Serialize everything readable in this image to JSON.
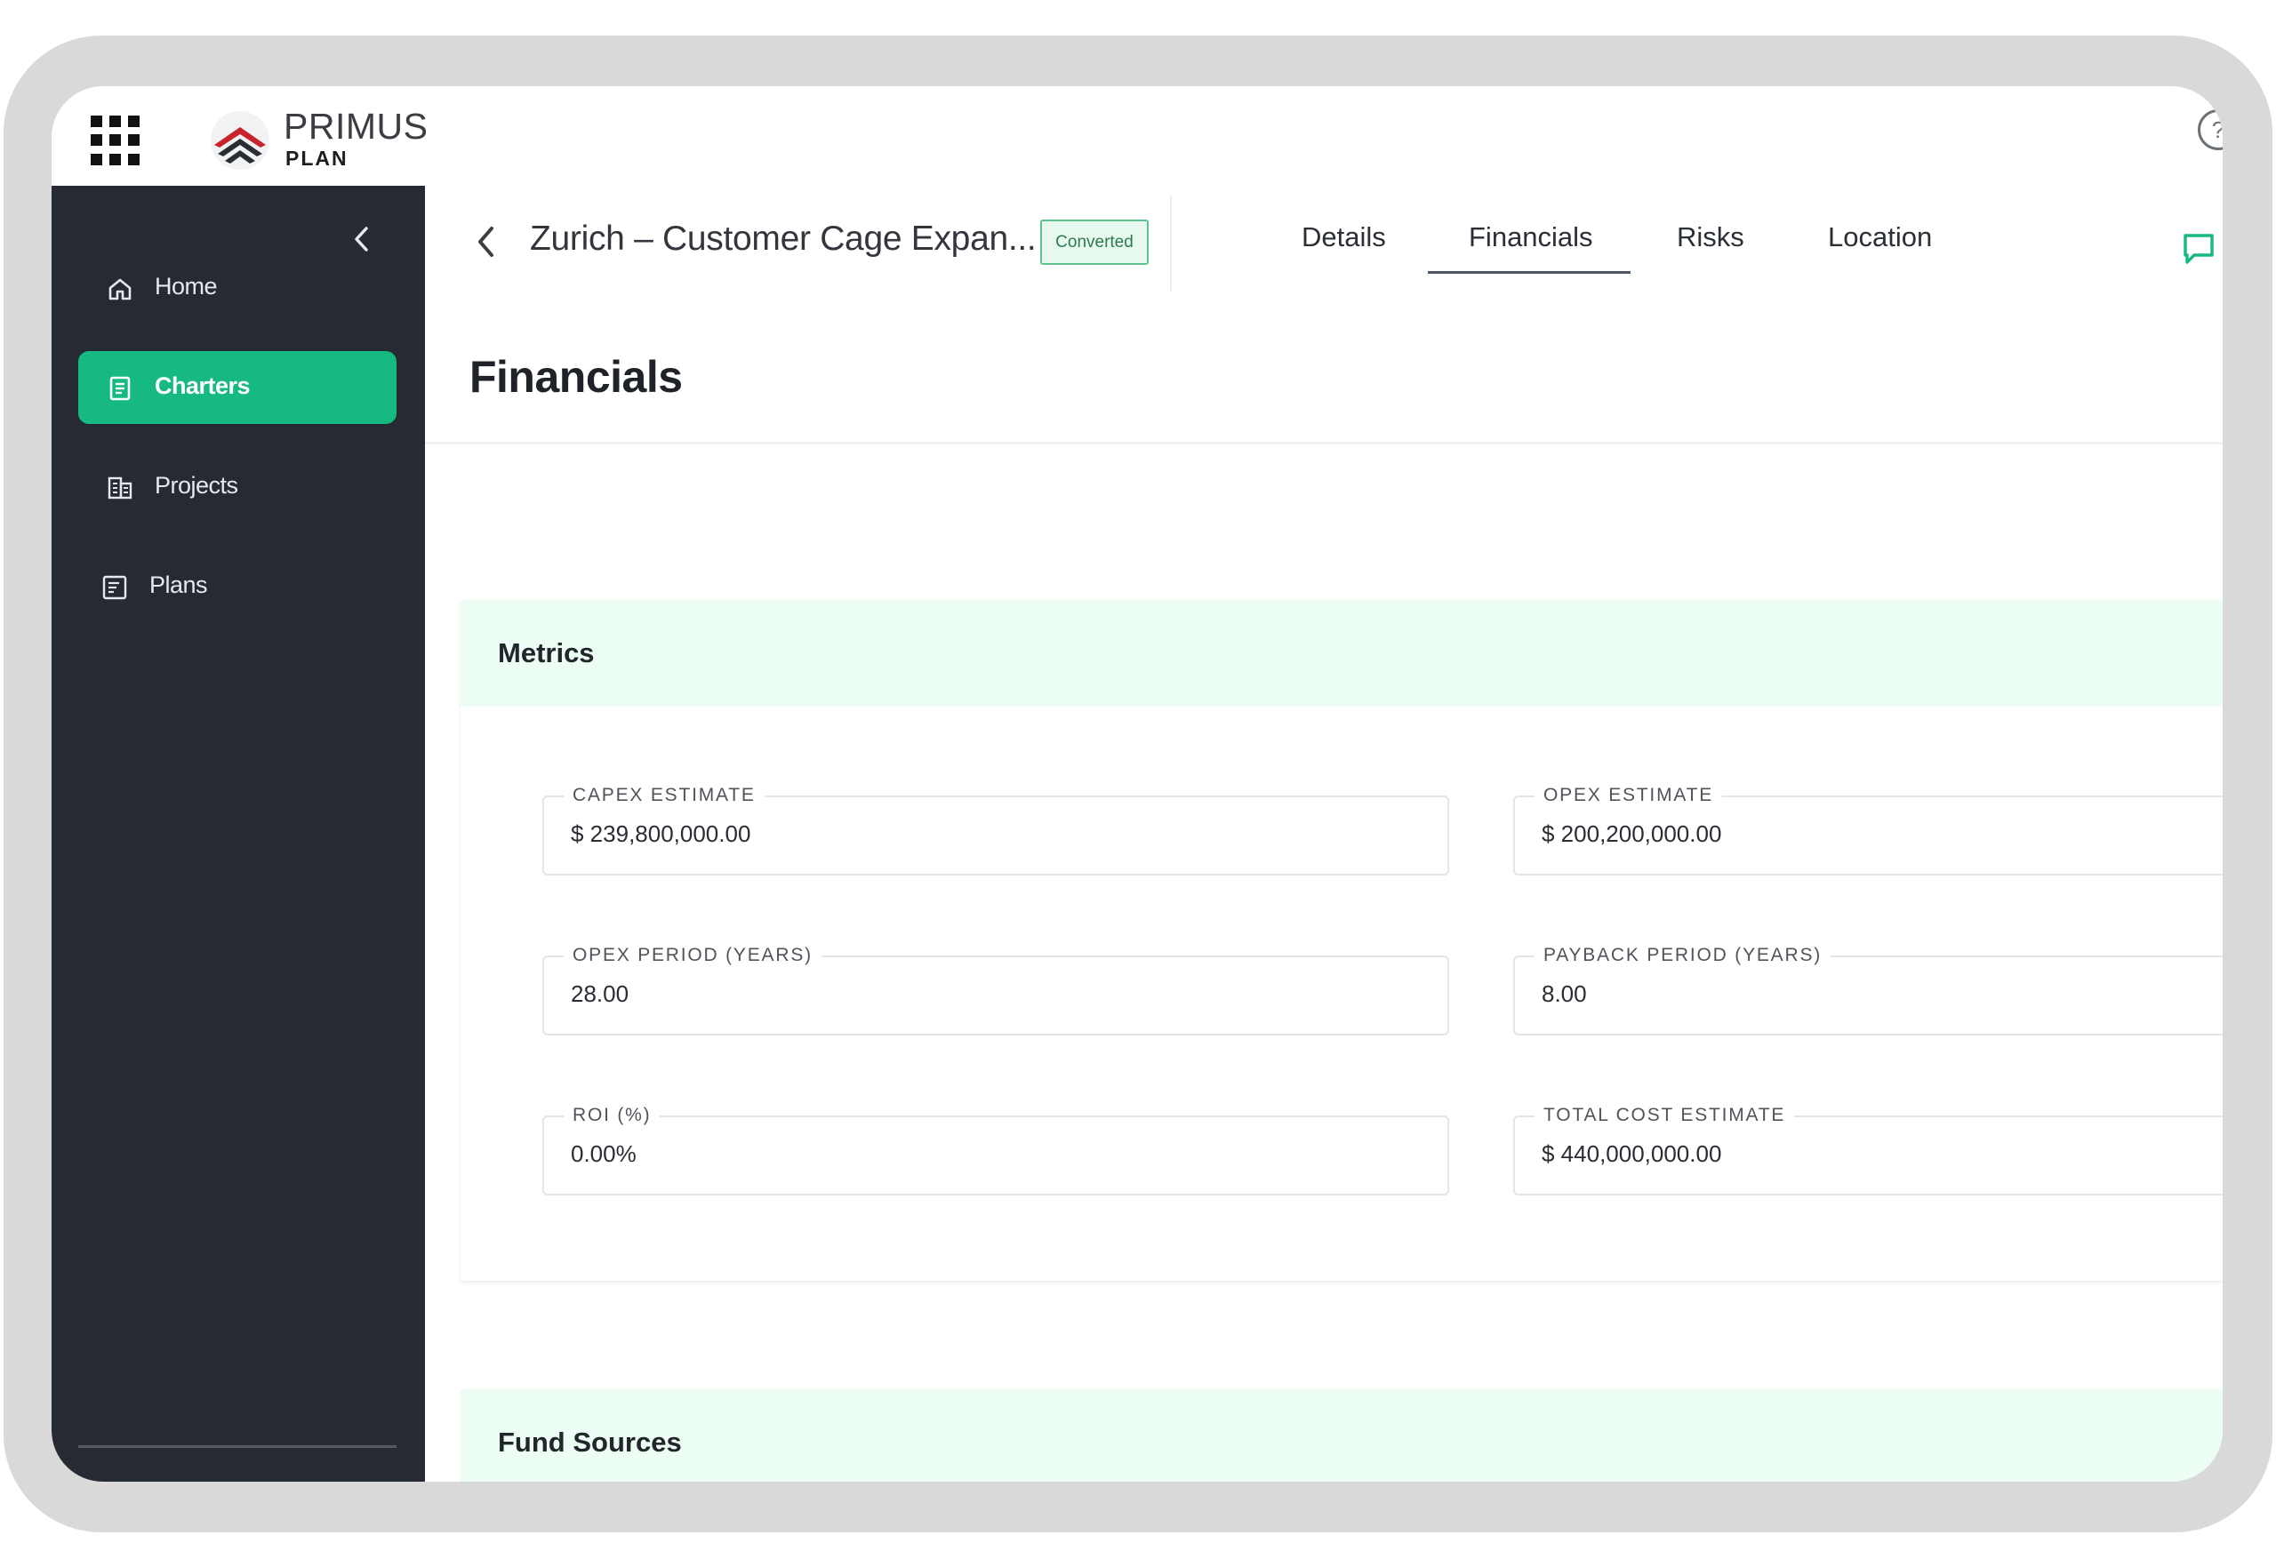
{
  "app": {
    "brand": "PRIMUS",
    "brand_sub": "PLAN",
    "help_icon": "help-circle-icon"
  },
  "sidebar": {
    "items": [
      {
        "label": "Home",
        "icon": "home-icon",
        "active": false
      },
      {
        "label": "Charters",
        "icon": "document-icon",
        "active": true
      },
      {
        "label": "Projects",
        "icon": "building-icon",
        "active": false
      },
      {
        "label": "Plans",
        "icon": "list-icon",
        "active": false
      }
    ]
  },
  "header": {
    "title": "Zurich – Customer Cage Expan...",
    "status": "Converted",
    "tabs": [
      "Details",
      "Financials",
      "Risks",
      "Location"
    ],
    "active_tab": "Financials"
  },
  "page": {
    "title": "Financials"
  },
  "metrics": {
    "title": "Metrics",
    "fields": [
      {
        "label": "CAPEX ESTIMATE",
        "value": "$ 239,800,000.00"
      },
      {
        "label": "OPEX ESTIMATE",
        "value": "$ 200,200,000.00"
      },
      {
        "label": "OPEX PERIOD (YEARS)",
        "value": "28.00"
      },
      {
        "label": "PAYBACK PERIOD (YEARS)",
        "value": "8.00"
      },
      {
        "label": "ROI (%)",
        "value": "0.00%"
      },
      {
        "label": "TOTAL COST ESTIMATE",
        "value": "$ 440,000,000.00"
      }
    ]
  },
  "fund_sources": {
    "title": "Fund Sources"
  },
  "colors": {
    "accent": "#15b981",
    "sidebar_bg": "#262a33",
    "card_header_bg": "#ecfdf4",
    "frame": "#d9d9d9"
  }
}
